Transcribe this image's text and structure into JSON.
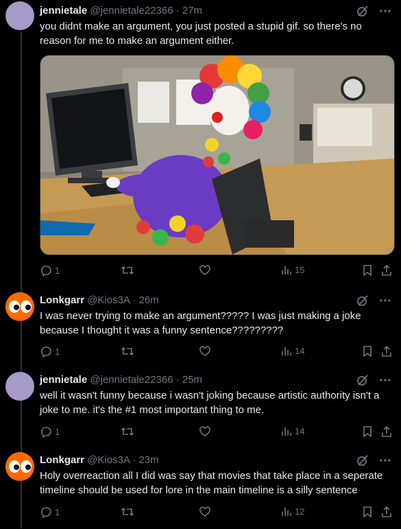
{
  "posts": [
    {
      "display_name": "jennietale",
      "handle_time": "@jennietale22366 · 27m",
      "text": "you didnt make an argument, you just posted a stupid gif. so there's no reason for me to make an argument either.",
      "actions": {
        "replies": "1",
        "views": "15"
      }
    },
    {
      "display_name": "Lonkgarr",
      "handle_time": "@Kios3A · 26m",
      "text": "I was never trying to make an argument????? I was just making a joke because I thought it was a funny sentence?????????",
      "actions": {
        "replies": "1",
        "views": "14"
      }
    },
    {
      "display_name": "jennietale",
      "handle_time": "@jennietale22366 · 25m",
      "text": "well it wasn't funny because i wasn't joking because artistic authority isn't a joke to me. it's the #1 most important thing to me.",
      "actions": {
        "replies": "1",
        "views": "14"
      }
    },
    {
      "display_name": "Lonkgarr",
      "handle_time": "@Kios3A · 23m",
      "text": "Holy overreaction all I did was say that movies that take place in a seperate timeline should be used for lore in the main timeline is a silly sentence",
      "actions": {
        "replies": "1",
        "views": "12"
      }
    }
  ],
  "icons": {
    "reply": "reply-icon",
    "repost": "repost-icon",
    "like": "like-icon",
    "views": "views-icon",
    "bookmark": "bookmark-icon",
    "share": "share-icon",
    "grok": "grok-icon",
    "more": "more-icon"
  },
  "colors": {
    "background": "#000000",
    "text": "#e7e9ea",
    "muted": "#71767b",
    "purple_avatar": "#a79ac9",
    "orange_avatar": "#ff6a00"
  }
}
